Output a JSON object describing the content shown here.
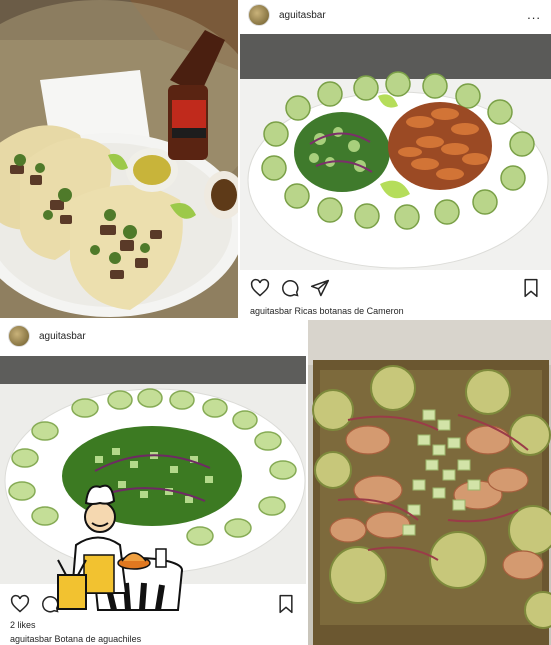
{
  "posts": [
    {
      "username": "aguitasbar",
      "caption_user": "aguitasbar",
      "caption_text": "Ricas botanas de Cameron",
      "more_label": "..."
    },
    {
      "username": "aguitasbar",
      "likes": "2 likes",
      "caption_user": "aguitasbar",
      "caption_text": "Botana de aguachiles",
      "more_label": "..."
    }
  ],
  "photos": {
    "tacos": "tacos-with-beer",
    "shrimp_platter": "cucumber-shrimp-platter",
    "aguachile_platter": "green-aguachile-platter",
    "aguachile_tray": "aguachile-tray"
  },
  "colors": {
    "plate_white": "#f4f4f2",
    "cucumber": "#a9c97a",
    "shrimp": "#c8692e",
    "aguachile": "#4c8a2e",
    "table_wood": "#8a7a5c"
  }
}
